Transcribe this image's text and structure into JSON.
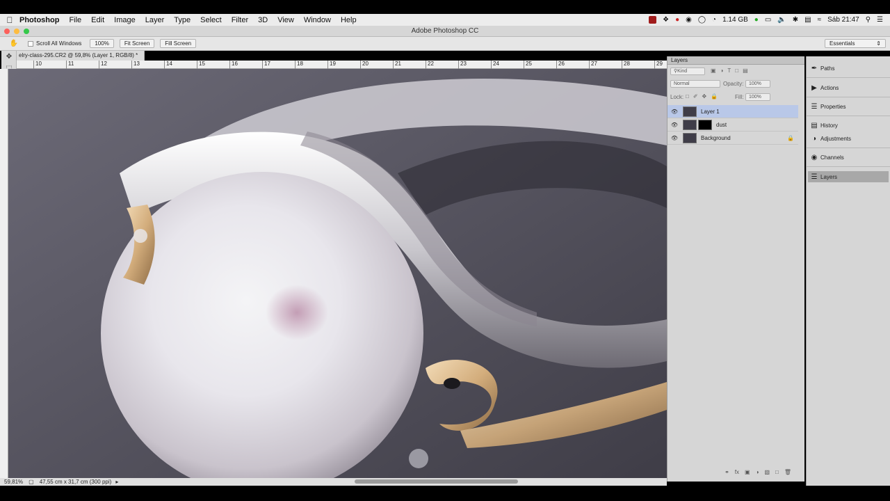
{
  "menubar": {
    "app": "Photoshop",
    "items": [
      "File",
      "Edit",
      "Image",
      "Layer",
      "Type",
      "Select",
      "Filter",
      "3D",
      "View",
      "Window",
      "Help"
    ],
    "memory": "1.14 GB",
    "clock": "Sáb 21:47"
  },
  "window": {
    "title": "Adobe Photoshop CC"
  },
  "options": {
    "scroll_all": "Scroll All Windows",
    "zoom_100": "100%",
    "fit_screen": "Fit Screen",
    "fill_screen": "Fill Screen",
    "workspace": "Essentials"
  },
  "document": {
    "tab": "elry-class-295.CR2 @ 59,8% (Layer 1, RGB/8) *",
    "ruler_marks": [
      "10",
      "11",
      "12",
      "13",
      "14",
      "15",
      "16",
      "17",
      "18",
      "19",
      "20",
      "21",
      "22",
      "23",
      "24",
      "25",
      "26",
      "27",
      "28",
      "29"
    ]
  },
  "status": {
    "zoom": "59,81%",
    "dimensions": "47,55 cm x 31,7 cm (300 ppi)"
  },
  "layers_panel": {
    "title": "Layers",
    "kind": "Kind",
    "blend": "Normal",
    "opacity_label": "Opacity:",
    "opacity": "100%",
    "lock_label": "Lock:",
    "fill_label": "Fill:",
    "fill": "100%",
    "layers": [
      {
        "name": "Layer 1",
        "selected": true
      },
      {
        "name": "dust",
        "selected": false
      },
      {
        "name": "Background",
        "selected": false
      }
    ]
  },
  "dock": {
    "items": [
      "Paths",
      "Actions",
      "Properties",
      "History",
      "Adjustments",
      "Channels",
      "Layers"
    ]
  }
}
